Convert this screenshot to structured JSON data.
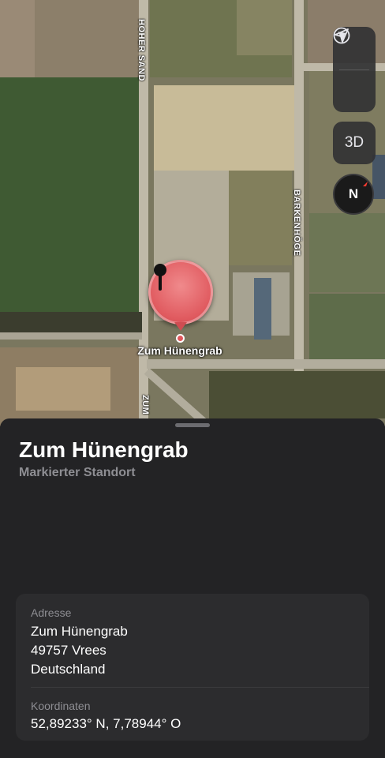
{
  "map": {
    "roads": {
      "left_vertical": "HOHER SAND",
      "right_vertical": "BARKENHÖGE",
      "bottom": "ZUM"
    },
    "controls": {
      "globe_icon": "globe-icon",
      "location_icon": "location-arrow-icon",
      "btn_3d_label": "3D",
      "compass_label": "N"
    },
    "pin": {
      "label": "Zum Hünengrab",
      "icon": "pushpin-icon",
      "color": "#e05a5f"
    }
  },
  "sheet": {
    "title": "Zum Hünengrab",
    "subtitle": "Markierter Standort",
    "address": {
      "label": "Adresse",
      "line1": "Zum Hünengrab",
      "line2": "49757 Vrees",
      "line3": "Deutschland"
    },
    "coordinates": {
      "label": "Koordinaten",
      "value": "52,89233° N, 7,78944° O"
    }
  }
}
